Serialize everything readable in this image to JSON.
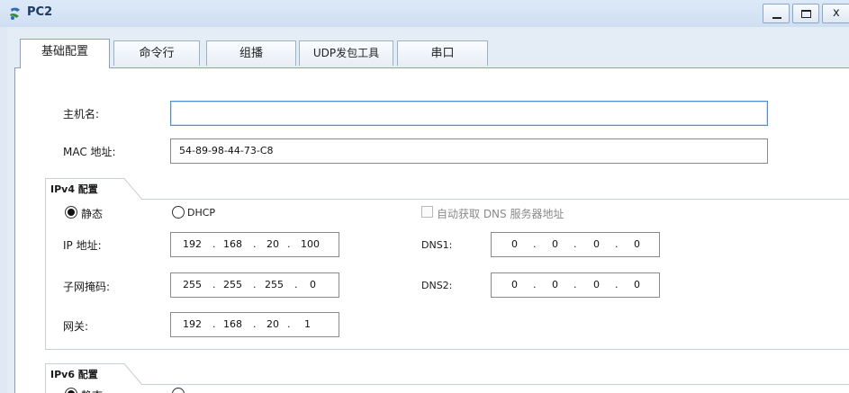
{
  "window": {
    "title": "PC2",
    "minimize": "_",
    "maximize": "□",
    "close": "x"
  },
  "tabs": [
    {
      "label": "基础配置"
    },
    {
      "label": "命令行"
    },
    {
      "label": "组播"
    },
    {
      "label": "UDP发包工具"
    },
    {
      "label": "串口"
    }
  ],
  "basic": {
    "hostname_label": "主机名:",
    "hostname_value": "",
    "mac_label": "MAC 地址:",
    "mac_value": "54-89-98-44-73-C8"
  },
  "ipv4": {
    "group_title": "IPv4 配置",
    "static_label": "静态",
    "dhcp_label": "DHCP",
    "auto_dns_label": "自动获取 DNS 服务器地址",
    "ip_label": "IP 地址:",
    "ip_octets": [
      "192",
      "168",
      "20",
      "100"
    ],
    "mask_label": "子网掩码:",
    "mask_octets": [
      "255",
      "255",
      "255",
      "0"
    ],
    "gateway_label": "网关:",
    "gateway_octets": [
      "192",
      "168",
      "20",
      "1"
    ],
    "dns1_label": "DNS1:",
    "dns1_octets": [
      "0",
      "0",
      "0",
      "0"
    ],
    "dns2_label": "DNS2:",
    "dns2_octets": [
      "0",
      "0",
      "0",
      "0"
    ]
  },
  "ipv6": {
    "group_title": "IPv6 配置",
    "static_label": "静态"
  }
}
